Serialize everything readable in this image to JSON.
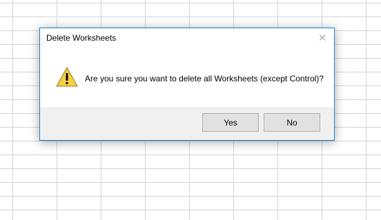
{
  "dialog": {
    "title": "Delete Worksheets",
    "close_glyph": "✕",
    "icon": "warning-icon",
    "message": "Are you sure you want to delete all Worksheets (except Control)?",
    "buttons": {
      "yes_label": "Yes",
      "no_label": "No"
    }
  },
  "colors": {
    "dialog_border": "#1883d7",
    "footer_bg": "#f0f0f0",
    "button_bg": "#e1e1e1",
    "warning_yellow": "#f9d03f",
    "grid_line": "#d4d4d4"
  }
}
